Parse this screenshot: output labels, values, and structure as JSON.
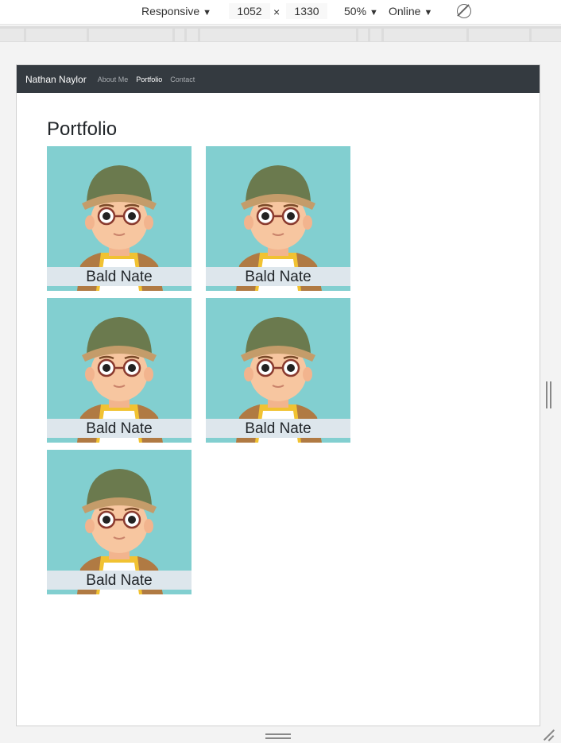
{
  "devtools": {
    "device": "Responsive",
    "width": "1052",
    "times": "×",
    "height": "1330",
    "zoom": "50%",
    "network": "Online",
    "caret": "▼",
    "rotate_icon": "rotate-icon"
  },
  "site": {
    "brand": "Nathan Naylor",
    "nav": [
      "About Me",
      "Portfolio",
      "Contact"
    ],
    "active_nav": "Portfolio",
    "page_title": "Portfolio",
    "cards": [
      {
        "caption": "Bald Nate"
      },
      {
        "caption": "Bald Nate"
      },
      {
        "caption": "Bald Nate"
      },
      {
        "caption": "Bald Nate"
      },
      {
        "caption": "Bald Nate"
      }
    ]
  },
  "colors": {
    "navbar": "#343a40",
    "card_bg": "#82cfd0",
    "caption_bg": "#dde6ec"
  }
}
